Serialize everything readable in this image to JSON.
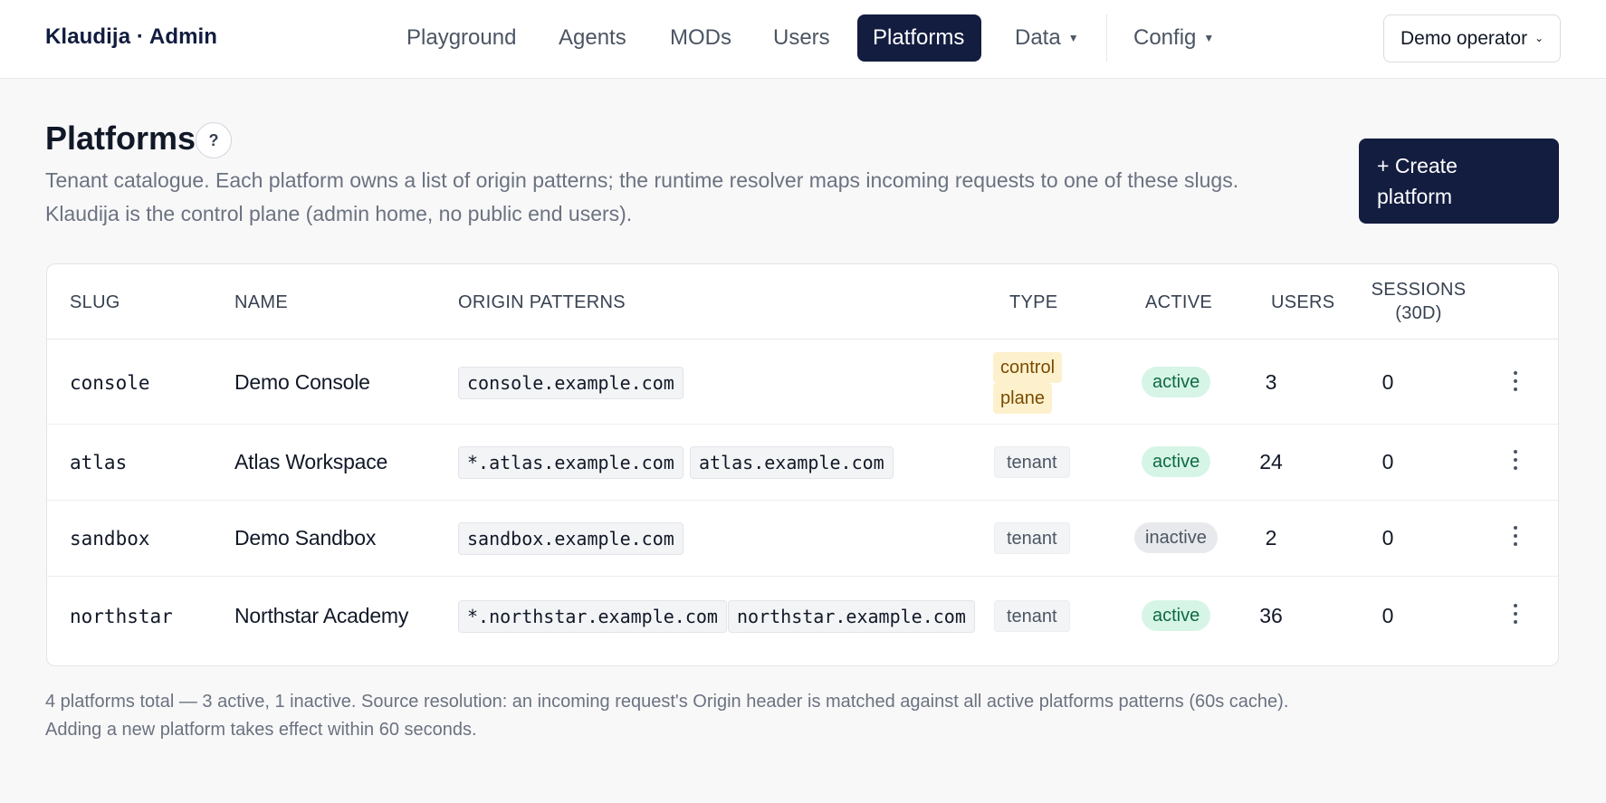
{
  "brand": "Klaudija · Admin",
  "nav": {
    "items": [
      "Playground",
      "Agents",
      "MODs",
      "Users",
      "Platforms",
      "Data",
      "Config"
    ],
    "active": "Platforms",
    "operator": "Demo operator"
  },
  "header": {
    "title": "Platforms",
    "help": "?",
    "description_line1": "Tenant catalogue. Each platform owns a list of origin patterns; the runtime resolver maps incoming requests to one of these slugs.",
    "description_line2": "Klaudija is the control plane (admin home, no public end users).",
    "create_line1": "+ Create",
    "create_line2": "platform"
  },
  "table": {
    "columns": [
      "SLUG",
      "NAME",
      "ORIGIN PATTERNS",
      "TYPE",
      "ACTIVE",
      "USERS",
      "SESSIONS",
      "(30D)"
    ],
    "rows": [
      {
        "slug": "console",
        "name": "Demo Console",
        "origins": [
          "console.example.com"
        ],
        "type_line1": "control",
        "type_line2": "plane",
        "status": "active",
        "users": "3",
        "sessions": "0"
      },
      {
        "slug": "atlas",
        "name": "Atlas Workspace",
        "origins": [
          "*.atlas.example.com",
          "atlas.example.com"
        ],
        "type": "tenant",
        "status": "active",
        "users": "24",
        "sessions": "0"
      },
      {
        "slug": "sandbox",
        "name": "Demo Sandbox",
        "origins": [
          "sandbox.example.com"
        ],
        "type": "tenant",
        "status": "inactive",
        "users": "2",
        "sessions": "0"
      },
      {
        "slug": "northstar",
        "name": "Northstar Academy",
        "origins": [
          "*.northstar.example.com",
          "northstar.example.com"
        ],
        "type": "tenant",
        "status": "active",
        "users": "36",
        "sessions": "0"
      }
    ]
  },
  "footer": {
    "line1": "4 platforms total — 3 active, 1 inactive. Source resolution: an incoming request's Origin header is matched against all active platforms patterns (60s cache).",
    "line2": "Adding a new platform takes effect within 60 seconds."
  },
  "colors": {
    "navy": "#131d40",
    "active_bg": "#d6f5e6",
    "active_text": "#0f6a43",
    "control_bg": "#fdf1cd"
  },
  "icons": [
    "help-icon",
    "caret-down-icon",
    "chevron-down-icon",
    "kebab-menu-icon"
  ]
}
